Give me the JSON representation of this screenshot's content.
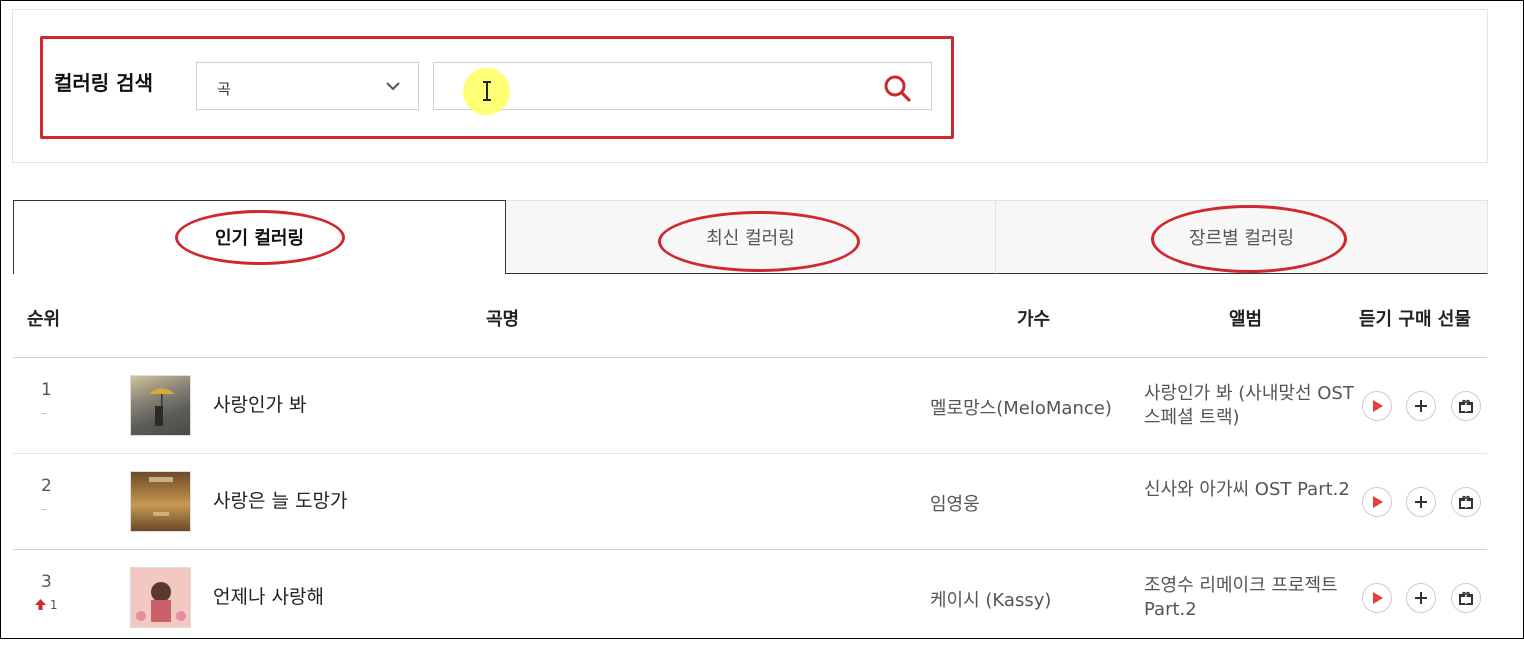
{
  "search": {
    "title": "컬러링 검색",
    "select_value": "곡",
    "input_value": "",
    "input_placeholder": ""
  },
  "tabs": [
    {
      "label": "인기 컬러링",
      "active": true
    },
    {
      "label": "최신 컬러링",
      "active": false
    },
    {
      "label": "장르별 컬러링",
      "active": false
    }
  ],
  "table": {
    "headers": {
      "rank": "순위",
      "title": "곡명",
      "artist": "가수",
      "album": "앨범",
      "actions": "듣기 구매 선물"
    },
    "rows": [
      {
        "rank": "1",
        "change": "–",
        "title": "사랑인가 봐",
        "artist": "멜로망스(MeloMance)",
        "album": "사랑인가 봐 (사내맞선 OST 스페셜 트랙)"
      },
      {
        "rank": "2",
        "change": "–",
        "title": "사랑은 늘 도망가",
        "artist": "임영웅",
        "album": "신사와 아가씨 OST Part.2"
      },
      {
        "rank": "3",
        "change": "1",
        "title": "언제나 사랑해",
        "artist": "케이시 (Kassy)",
        "album": "조영수 리메이크 프로젝트 Part.2"
      }
    ]
  },
  "icons": {
    "search": "search-icon",
    "dropdown": "chevron-down-icon",
    "play": "play-icon",
    "add": "plus-icon",
    "gift": "gift-icon",
    "rank_up": "arrow-up-icon"
  },
  "colors": {
    "accent": "#d0282e",
    "play": "#e5403a"
  }
}
